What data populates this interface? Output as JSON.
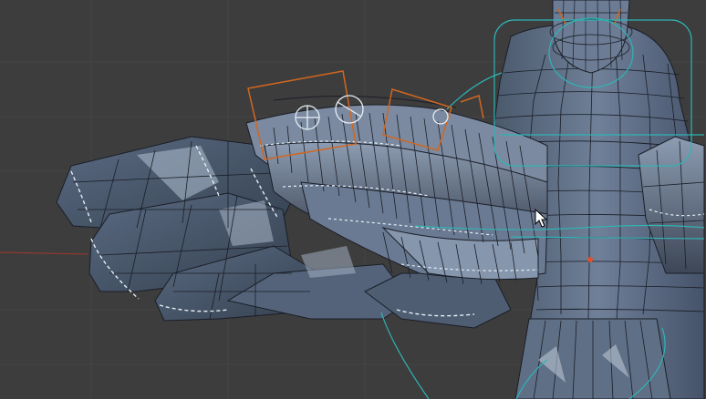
{
  "viewport": {
    "mode": "edit-mode",
    "colors": {
      "background": "#3d3d3d",
      "grid": "#454545",
      "x_axis": "#8f3a2e",
      "mesh_fill": "#566579",
      "mesh_light": "#a9b7c9",
      "mesh_dark": "#2e3746",
      "wire": "#1a1e27",
      "seam": "#e6eef5",
      "bone_selected": "#d2661f",
      "bone_control": "#2fb4b4",
      "pivot": "#e0522a"
    },
    "icons": [
      "arrow-cursor-icon",
      "pivot-dot-icon"
    ]
  }
}
